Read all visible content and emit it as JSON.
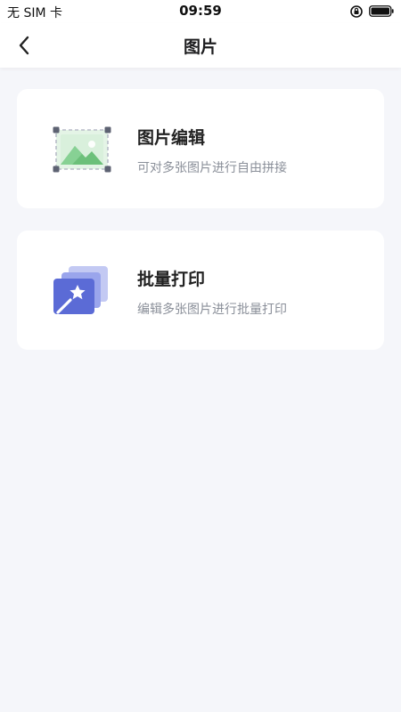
{
  "status_bar": {
    "carrier": "无 SIM 卡",
    "time": "09:59",
    "icons": [
      "rotation-lock-icon",
      "battery-icon"
    ]
  },
  "nav": {
    "title": "图片",
    "back_icon": "chevron-left-icon"
  },
  "cards": [
    {
      "title": "图片编辑",
      "description": "可对多张图片进行自由拼接",
      "icon": "image-edit-icon"
    },
    {
      "title": "批量打印",
      "description": "编辑多张图片进行批量打印",
      "icon": "batch-print-icon"
    }
  ],
  "colors": {
    "background": "#f5f6fa",
    "card": "#ffffff",
    "title_text": "#222222",
    "desc_text": "#8a8f99",
    "image_icon_green": "#6cc07a",
    "print_icon_blue": "#5b6bd6",
    "print_icon_light": "#b9c0f0"
  }
}
